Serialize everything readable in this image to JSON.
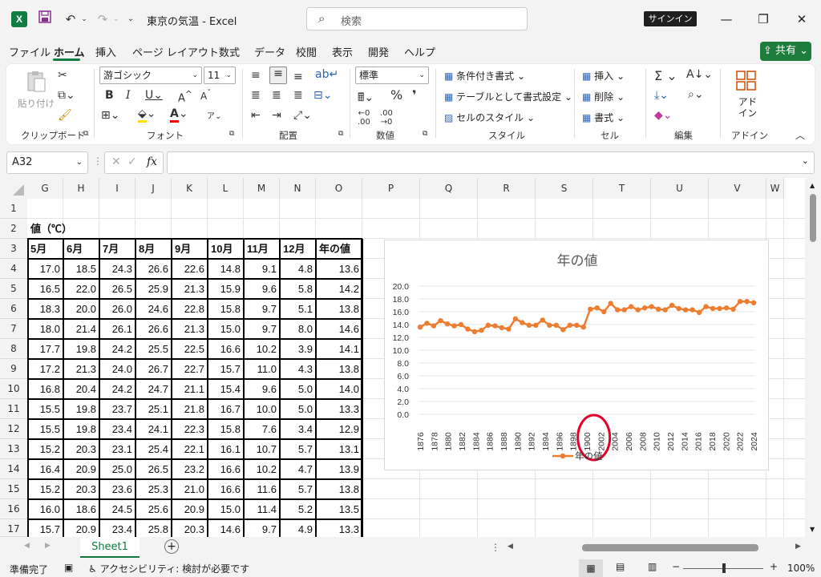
{
  "app": {
    "logo_letter": "X",
    "doc_title": "東京の気温  -  Excel",
    "search_placeholder": "検索",
    "signin_label": "サインイン",
    "share_label": "共有"
  },
  "menu": [
    "ファイル",
    "ホーム",
    "挿入",
    "ページ レイアウト",
    "数式",
    "データ",
    "校閲",
    "表示",
    "開発",
    "ヘルプ"
  ],
  "ribbon": {
    "clipboard": {
      "paste": "貼り付け",
      "label": "クリップボード"
    },
    "font": {
      "name": "游ゴシック",
      "size": "11",
      "label": "フォント"
    },
    "alignment": {
      "label": "配置"
    },
    "number": {
      "format": "標準",
      "label": "数値"
    },
    "styles": {
      "conditional": "条件付き書式",
      "table": "テーブルとして書式設定",
      "cell_styles": "セルのスタイル",
      "label": "スタイル"
    },
    "cells": {
      "insert": "挿入",
      "delete": "削除",
      "format": "書式",
      "label": "セル"
    },
    "editing": {
      "label": "編集"
    },
    "addins": {
      "button": "アド\nイン",
      "label": "アドイン"
    }
  },
  "formula": {
    "name_box": "A32",
    "fx": "fx",
    "value": ""
  },
  "grid": {
    "columns": [
      "G",
      "H",
      "I",
      "J",
      "K",
      "L",
      "M",
      "N",
      "O",
      "P",
      "Q",
      "R",
      "S",
      "T",
      "U",
      "V",
      "W"
    ],
    "rows": [
      "1",
      "2",
      "3",
      "4",
      "5",
      "6",
      "7",
      "8",
      "9",
      "10",
      "11",
      "12",
      "13",
      "14",
      "15",
      "16",
      "17"
    ],
    "title_cell": "値（℃）",
    "headers": [
      "5月",
      "6月",
      "7月",
      "8月",
      "9月",
      "10月",
      "11月",
      "12月",
      "年の値"
    ],
    "data": [
      [
        "17.0",
        "18.5",
        "24.3",
        "26.6",
        "22.6",
        "14.8",
        "9.1",
        "4.8",
        "13.6"
      ],
      [
        "16.5",
        "22.0",
        "26.5",
        "25.9",
        "21.3",
        "15.9",
        "9.6",
        "5.8",
        "14.2"
      ],
      [
        "18.3",
        "20.0",
        "26.0",
        "24.6",
        "22.8",
        "15.8",
        "9.7",
        "5.1",
        "13.8"
      ],
      [
        "18.0",
        "21.4",
        "26.1",
        "26.6",
        "21.3",
        "15.0",
        "9.7",
        "8.0",
        "14.6"
      ],
      [
        "17.7",
        "19.8",
        "24.2",
        "25.5",
        "22.5",
        "16.6",
        "10.2",
        "3.9",
        "14.1"
      ],
      [
        "17.2",
        "21.3",
        "24.0",
        "26.7",
        "22.7",
        "15.7",
        "11.0",
        "4.3",
        "13.8"
      ],
      [
        "16.8",
        "20.4",
        "24.2",
        "24.7",
        "21.1",
        "15.4",
        "9.6",
        "5.0",
        "14.0"
      ],
      [
        "15.5",
        "19.8",
        "23.7",
        "25.1",
        "21.8",
        "16.7",
        "10.0",
        "5.0",
        "13.3"
      ],
      [
        "15.5",
        "19.8",
        "23.4",
        "24.1",
        "22.3",
        "15.8",
        "7.6",
        "3.4",
        "12.9"
      ],
      [
        "15.2",
        "20.3",
        "23.1",
        "25.4",
        "22.1",
        "16.1",
        "10.7",
        "5.7",
        "13.1"
      ],
      [
        "16.4",
        "20.9",
        "25.0",
        "26.5",
        "23.2",
        "16.6",
        "10.2",
        "4.7",
        "13.9"
      ],
      [
        "15.2",
        "20.3",
        "23.6",
        "25.3",
        "21.0",
        "16.6",
        "11.6",
        "5.7",
        "13.8"
      ],
      [
        "16.0",
        "18.6",
        "24.5",
        "25.6",
        "20.9",
        "15.0",
        "11.4",
        "5.2",
        "13.5"
      ],
      [
        "15.7",
        "20.9",
        "23.4",
        "25.8",
        "20.3",
        "14.6",
        "9.7",
        "4.9",
        "13.3"
      ]
    ]
  },
  "chart_data": {
    "type": "line",
    "title": "年の値",
    "categories": [
      "1876",
      "1878",
      "1880",
      "1882",
      "1884",
      "1886",
      "1888",
      "1890",
      "1892",
      "1894",
      "1896",
      "1898",
      "1900",
      "2002",
      "2004",
      "2006",
      "2008",
      "2010",
      "2012",
      "2014",
      "2016",
      "2018",
      "2020",
      "2022",
      "2024"
    ],
    "series": [
      {
        "name": "年の値",
        "color": "#ed7d31",
        "values": [
          13.6,
          14.2,
          13.8,
          14.6,
          14.1,
          13.8,
          14.0,
          13.3,
          12.9,
          13.1,
          13.9,
          13.8,
          13.5,
          13.3,
          14.9,
          14.3,
          13.9,
          13.9,
          14.7,
          13.9,
          13.9,
          13.2,
          13.9,
          13.9,
          13.6,
          16.4,
          16.6,
          16.0,
          17.3,
          16.3,
          16.3,
          16.8,
          16.3,
          16.6,
          16.8,
          16.4,
          16.3,
          17.0,
          16.5,
          16.3,
          16.3,
          15.9,
          16.8,
          16.5,
          16.5,
          16.6,
          16.4,
          17.6,
          17.6,
          17.4
        ]
      }
    ],
    "ylim": [
      0,
      20
    ],
    "yticks": [
      "0.0",
      "2.0",
      "4.0",
      "6.0",
      "8.0",
      "10.0",
      "12.0",
      "14.0",
      "16.0",
      "18.0",
      "20.0"
    ],
    "legend": "bottom",
    "annotation": "red circle around 1900 / 2002 axis labels"
  },
  "sheet_tabs": [
    "Sheet1"
  ],
  "status": {
    "ready": "準備完了",
    "accessibility": "アクセシビリティ: 検討が必要です",
    "zoom": "100%"
  }
}
